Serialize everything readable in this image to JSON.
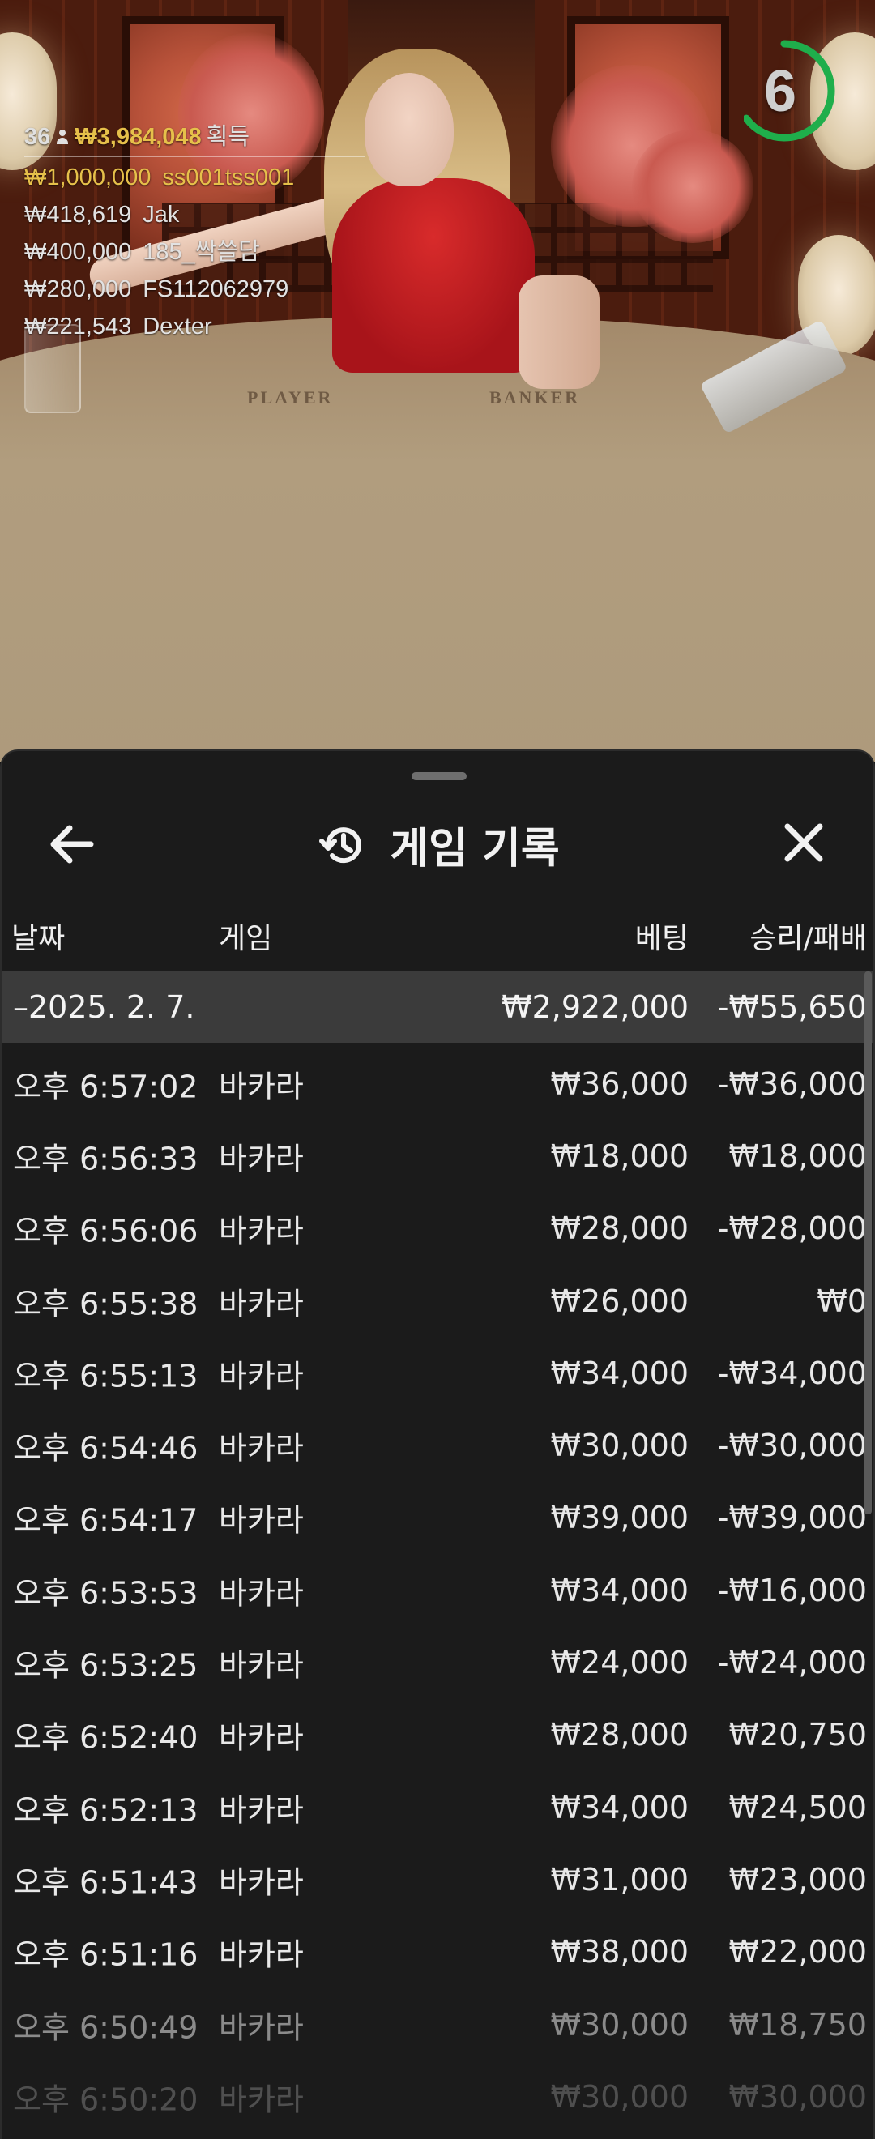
{
  "leaderboard": {
    "players_count": "36",
    "total_amount": "₩3,984,048",
    "total_suffix": "획득",
    "entries": [
      {
        "amount": "₩1,000,000",
        "name": "ss001tss001",
        "highlight": true
      },
      {
        "amount": "₩418,619",
        "name": "Jak"
      },
      {
        "amount": "₩400,000",
        "name": "185_싹쓸담"
      },
      {
        "amount": "₩280,000",
        "name": "FS112062979"
      },
      {
        "amount": "₩221,543",
        "name": "Dexter"
      }
    ]
  },
  "timer": {
    "value": "6",
    "color": "#1fae4b",
    "progress": 0.65
  },
  "table_labels": {
    "player": "PLAYER",
    "banker": "BANKER"
  },
  "sheet": {
    "title": "게임 기록",
    "title_icon": "history-icon",
    "back_icon": "arrow-left-icon",
    "close_icon": "close-icon",
    "columns": {
      "date": "날짜",
      "game": "게임",
      "bet": "베팅",
      "win_loss": "승리/패배"
    },
    "date_group": {
      "date": "–2025. 2. 7.",
      "bet": "₩2,922,000",
      "win_loss": "-₩55,650"
    },
    "rows": [
      {
        "time": "오후 6:57:02",
        "game": "바카라",
        "bet": "₩36,000",
        "win_loss": "-₩36,000"
      },
      {
        "time": "오후 6:56:33",
        "game": "바카라",
        "bet": "₩18,000",
        "win_loss": "₩18,000"
      },
      {
        "time": "오후 6:56:06",
        "game": "바카라",
        "bet": "₩28,000",
        "win_loss": "-₩28,000"
      },
      {
        "time": "오후 6:55:38",
        "game": "바카라",
        "bet": "₩26,000",
        "win_loss": "₩0"
      },
      {
        "time": "오후 6:55:13",
        "game": "바카라",
        "bet": "₩34,000",
        "win_loss": "-₩34,000"
      },
      {
        "time": "오후 6:54:46",
        "game": "바카라",
        "bet": "₩30,000",
        "win_loss": "-₩30,000"
      },
      {
        "time": "오후 6:54:17",
        "game": "바카라",
        "bet": "₩39,000",
        "win_loss": "-₩39,000"
      },
      {
        "time": "오후 6:53:53",
        "game": "바카라",
        "bet": "₩34,000",
        "win_loss": "-₩16,000"
      },
      {
        "time": "오후 6:53:25",
        "game": "바카라",
        "bet": "₩24,000",
        "win_loss": "-₩24,000"
      },
      {
        "time": "오후 6:52:40",
        "game": "바카라",
        "bet": "₩28,000",
        "win_loss": "₩20,750"
      },
      {
        "time": "오후 6:52:13",
        "game": "바카라",
        "bet": "₩34,000",
        "win_loss": "₩24,500"
      },
      {
        "time": "오후 6:51:43",
        "game": "바카라",
        "bet": "₩31,000",
        "win_loss": "₩23,000"
      },
      {
        "time": "오후 6:51:16",
        "game": "바카라",
        "bet": "₩38,000",
        "win_loss": "₩22,000"
      },
      {
        "time": "오후 6:50:49",
        "game": "바카라",
        "bet": "₩30,000",
        "win_loss": "₩18,750"
      },
      {
        "time": "오후 6:50:20",
        "game": "바카라",
        "bet": "₩30,000",
        "win_loss": "₩30,000"
      }
    ]
  }
}
